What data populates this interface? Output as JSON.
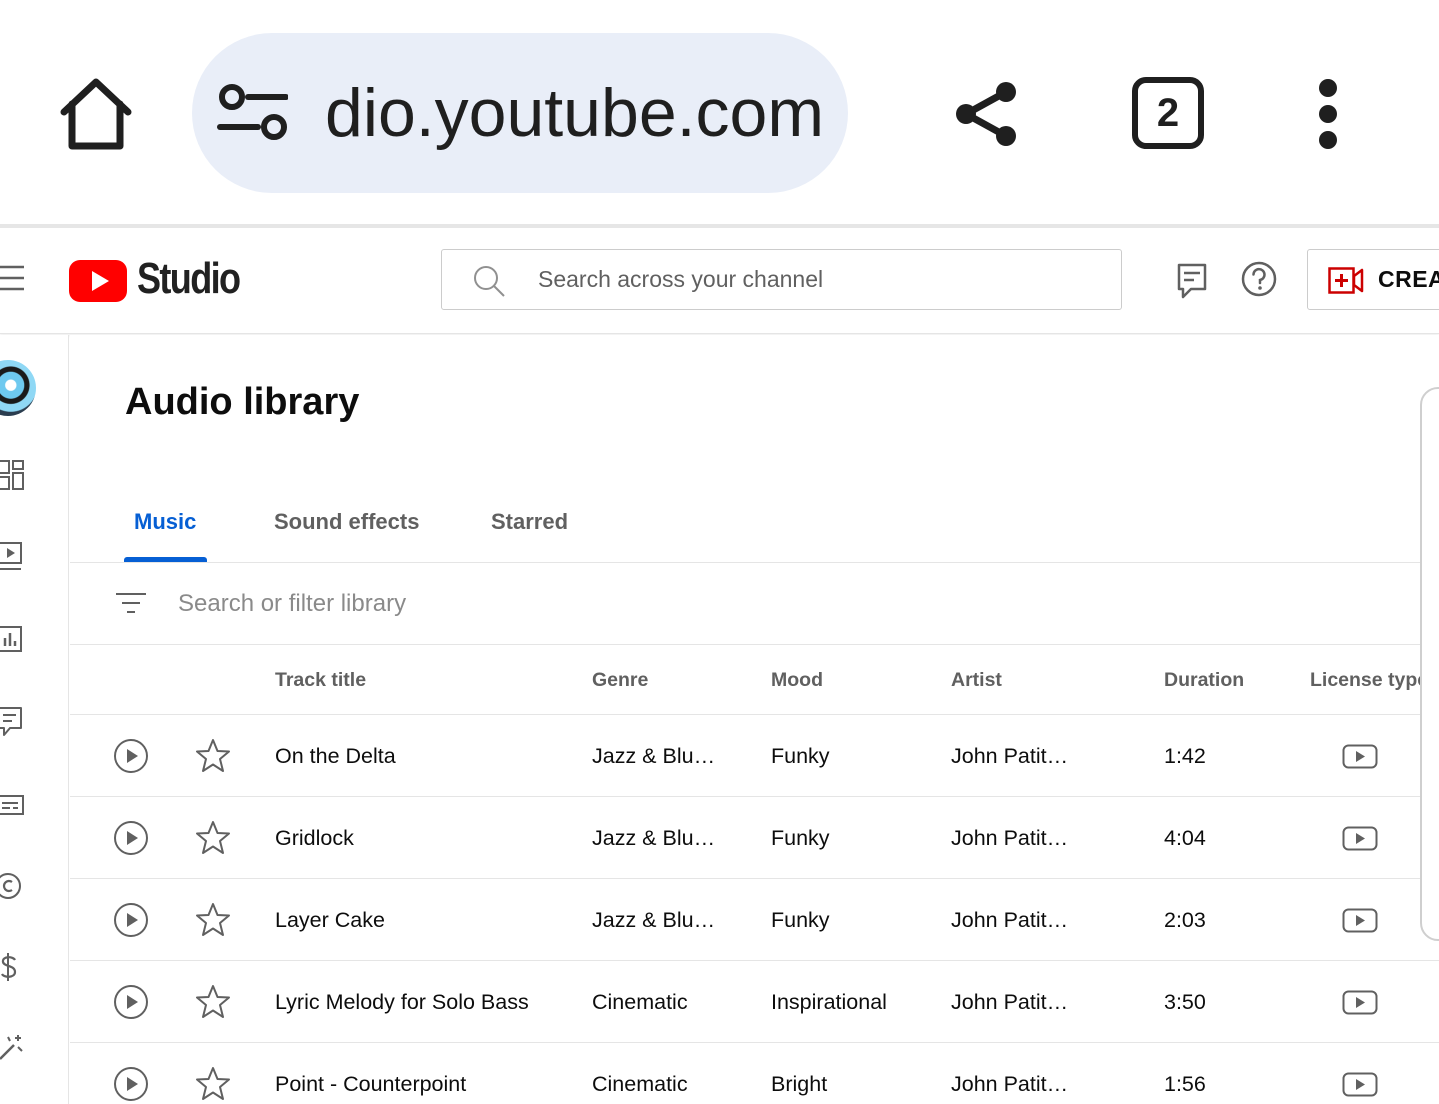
{
  "browser": {
    "url": "dio.youtube.com",
    "tab_count": "2",
    "icons": [
      "home-icon",
      "site-settings-icon",
      "share-icon",
      "tab-switcher-icon",
      "more-vert-icon"
    ]
  },
  "header": {
    "logo_text": "Studio",
    "search_placeholder": "Search across your channel",
    "create_label": "CREATE",
    "icons": [
      "menu-icon",
      "youtube-logo-icon",
      "search-icon",
      "feedback-icon",
      "help-icon",
      "create-video-icon"
    ],
    "brand_color": "#ff0000"
  },
  "nav": {
    "icons": [
      "dashboard-icon",
      "content-icon",
      "analytics-icon",
      "comments-icon",
      "subtitles-icon",
      "copyright-icon",
      "earn-icon",
      "customization-icon"
    ]
  },
  "page": {
    "title": "Audio library",
    "tabs": [
      {
        "label": "Music",
        "active": true
      },
      {
        "label": "Sound effects",
        "active": false
      },
      {
        "label": "Starred",
        "active": false
      }
    ],
    "filter_placeholder": "Search or filter library",
    "accent_color": "#065fd4"
  },
  "table": {
    "columns": {
      "title": "Track title",
      "genre": "Genre",
      "mood": "Mood",
      "artist": "Artist",
      "duration": "Duration",
      "license": "License type"
    },
    "rows": [
      {
        "title": "On the Delta",
        "genre": "Jazz & Blu…",
        "mood": "Funky",
        "artist": "John Patit…",
        "duration": "1:42",
        "license_icon": "youtube-license-icon"
      },
      {
        "title": "Gridlock",
        "genre": "Jazz & Blu…",
        "mood": "Funky",
        "artist": "John Patit…",
        "duration": "4:04",
        "license_icon": "youtube-license-icon"
      },
      {
        "title": "Layer Cake",
        "genre": "Jazz & Blu…",
        "mood": "Funky",
        "artist": "John Patit…",
        "duration": "2:03",
        "license_icon": "youtube-license-icon"
      },
      {
        "title": "Lyric Melody for Solo Bass",
        "genre": "Cinematic",
        "mood": "Inspirational",
        "artist": "John Patit…",
        "duration": "3:50",
        "license_icon": "youtube-license-icon"
      },
      {
        "title": "Point - Counterpoint",
        "genre": "Cinematic",
        "mood": "Bright",
        "artist": "John Patit…",
        "duration": "1:56",
        "license_icon": "youtube-license-icon"
      }
    ]
  }
}
